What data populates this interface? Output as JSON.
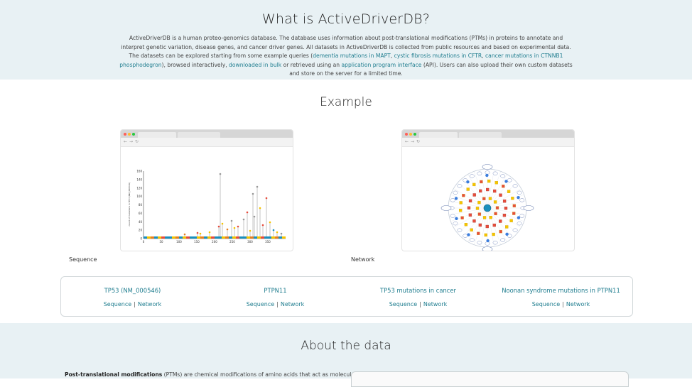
{
  "intro": {
    "title": "What is ActiveDriverDB?",
    "p_text1": "ActiveDriverDB is a human proteo-genomics database. The database uses information about post-translational modifications (PTMs) in proteins to annotate and interpret genetic variation, disease genes, and cancer driver genes. All datasets in ActiveDriverDB is collected from public resources and based on experimental data. The datasets can be explored starting from some example queries (",
    "link_mapt": "dementia mutations in MAPT",
    "sep_comma1": ", ",
    "link_cftr": "cystic fibrosis mutations in CFTR",
    "sep_comma2": ", ",
    "link_ctnnb1": "cancer mutations in CTNNB1 phosphodegron",
    "p_text2": "), browsed interactively, ",
    "link_download": "downloaded in bulk",
    "p_text3": " or retrieved using an ",
    "link_api": "application program interface",
    "p_text4": " (API). Users can also upload their own custom datasets and store on the server for a limited time."
  },
  "example": {
    "title": "Example",
    "caption_sequence": "Sequence",
    "caption_network": "Network",
    "columns": [
      {
        "head": "TP53 (NM_000546)",
        "seq": "Sequence",
        "sep": "|",
        "net": "Network"
      },
      {
        "head": "PTPN11",
        "seq": "Sequence",
        "sep": "|",
        "net": "Network"
      },
      {
        "head": "TP53 mutations in cancer",
        "seq": "Sequence",
        "sep": "|",
        "net": "Network"
      },
      {
        "head": "Noonan syndrome mutations in PTPN11",
        "seq": "Sequence",
        "sep": "|",
        "net": "Network"
      }
    ]
  },
  "seq_plot": {
    "ylabel": "count of mutations in TP53 (NM_000546)",
    "yticks": [
      "0",
      "20",
      "40",
      "60",
      "80",
      "100",
      "120",
      "140",
      "160"
    ],
    "xticks": [
      "0",
      "50",
      "100",
      "150",
      "200",
      "250",
      "300",
      "350"
    ]
  },
  "about": {
    "title": "About the data",
    "ptm_bold": "Post-translational modifications",
    "ptm_text": " (PTMs) are chemical modifications of amino acids that act as molecular switches and"
  },
  "colors": {
    "link": "#1f7d8f",
    "band": "#e8f1f4",
    "dot_red": "#ff5f57",
    "dot_yellow": "#febc2e",
    "dot_green": "#28c840"
  }
}
